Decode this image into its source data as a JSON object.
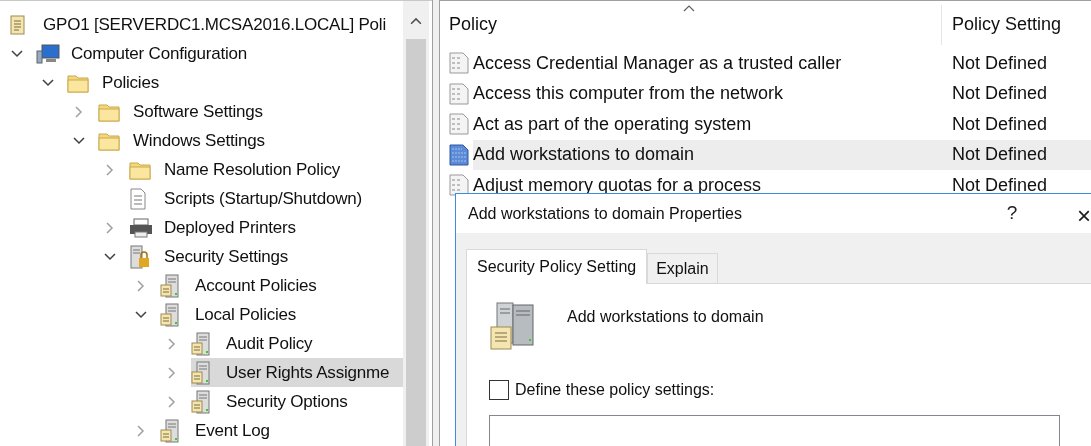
{
  "tree": {
    "label": "GPO1 [SERVERDC1.MCSA2016.LOCAL] Poli",
    "kind": "scroll",
    "selected": false,
    "children": [
      {
        "label": "Computer Configuration",
        "kind": "computer",
        "expanded": true,
        "selected": false,
        "children": [
          {
            "label": "Policies",
            "kind": "folder",
            "expanded": true,
            "selected": false,
            "children": [
              {
                "label": "Software Settings",
                "kind": "folder",
                "expanded": false,
                "selected": false
              },
              {
                "label": "Windows Settings",
                "kind": "folder",
                "expanded": true,
                "selected": false,
                "children": [
                  {
                    "label": "Name Resolution Policy",
                    "kind": "folder",
                    "expanded": false,
                    "selected": false
                  },
                  {
                    "label": "Scripts (Startup/Shutdown)",
                    "kind": "script",
                    "selected": false
                  },
                  {
                    "label": "Deployed Printers",
                    "kind": "printer",
                    "expanded": false,
                    "selected": false
                  },
                  {
                    "label": "Security Settings",
                    "kind": "lock",
                    "expanded": true,
                    "selected": false,
                    "children": [
                      {
                        "label": "Account Policies",
                        "kind": "server",
                        "expanded": false,
                        "selected": false
                      },
                      {
                        "label": "Local Policies",
                        "kind": "server",
                        "expanded": true,
                        "selected": false,
                        "children": [
                          {
                            "label": "Audit Policy",
                            "kind": "server",
                            "expanded": false,
                            "selected": false
                          },
                          {
                            "label": "User Rights Assignme",
                            "kind": "server",
                            "expanded": false,
                            "selected": true
                          },
                          {
                            "label": "Security Options",
                            "kind": "server",
                            "expanded": false,
                            "selected": false
                          }
                        ]
                      },
                      {
                        "label": "Event Log",
                        "kind": "server",
                        "expanded": false,
                        "selected": false
                      }
                    ]
                  }
                ]
              }
            ]
          }
        ]
      }
    ]
  },
  "list": {
    "columns": [
      "Policy",
      "Policy Setting"
    ],
    "rows": [
      {
        "policy": "Access Credential Manager as a trusted caller",
        "setting": "Not Defined",
        "selected": false
      },
      {
        "policy": "Access this computer from the network",
        "setting": "Not Defined",
        "selected": false
      },
      {
        "policy": "Act as part of the operating system",
        "setting": "Not Defined",
        "selected": false
      },
      {
        "policy": "Add workstations to domain",
        "setting": "Not Defined",
        "selected": true
      },
      {
        "policy": "Adjust memory quotas for a process",
        "setting": "Not Defined",
        "selected": false
      }
    ]
  },
  "dialog": {
    "title": "Add workstations to domain Properties",
    "help": "?",
    "close": "×",
    "tabs": [
      {
        "label": "Security Policy Setting",
        "selected": true
      },
      {
        "label": "Explain",
        "selected": false
      }
    ],
    "policy_name": "Add workstations to domain",
    "define": {
      "label": "Define these policy settings:",
      "checked": false
    }
  }
}
